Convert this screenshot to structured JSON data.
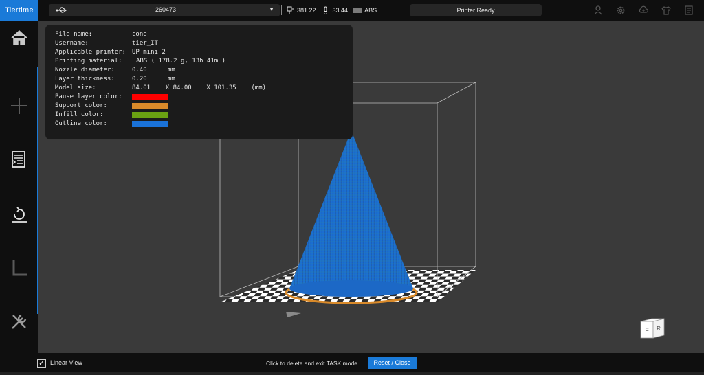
{
  "app": {
    "brand": "Tiertime"
  },
  "sidebar": {
    "items": [
      {
        "icon": "home-icon"
      },
      {
        "icon": "add-icon"
      },
      {
        "icon": "print-task-icon"
      },
      {
        "icon": "calibrate-icon"
      },
      {
        "icon": "measure-icon"
      },
      {
        "icon": "tools-icon"
      }
    ]
  },
  "topbar": {
    "printer_name": "260473",
    "nozzle_temp": "381.22",
    "bed_temp": "33.44",
    "material": "ABS",
    "status": "Printer Ready"
  },
  "info_panel": {
    "file_name_label": "File name:",
    "file_name": "cone",
    "username_label": "Username:",
    "username": "tier_IT",
    "printer_label": "Applicable printer:",
    "printer": "UP mini 2",
    "material_label": "Printing material:",
    "material": "ABS ( 178.2 g,  13h 41m )",
    "nozzle_label": "Nozzle diameter:",
    "nozzle_value": "0.40",
    "nozzle_unit": "mm",
    "layer_label": "Layer thickness:",
    "layer_value": "0.20",
    "layer_unit": "mm",
    "size_label": "Model size:",
    "size_value": "84.01    X 84.00    X 101.35    (mm)",
    "pause_label": "Pause layer color:",
    "support_label": "Support color:",
    "infill_label": "Infill color:",
    "outline_label": "Outline color:",
    "colors": {
      "pause": "#ff0000",
      "support": "#d98a2a",
      "infill": "#6aa012",
      "outline": "#1a72d8"
    }
  },
  "view_cube": {
    "front": "F",
    "right": "R"
  },
  "bottombar": {
    "linear_view_label": "Linear View",
    "linear_view_checked": "✓",
    "task_message": "Click to delete and exit TASK mode.",
    "reset_label": "Reset / Close"
  }
}
